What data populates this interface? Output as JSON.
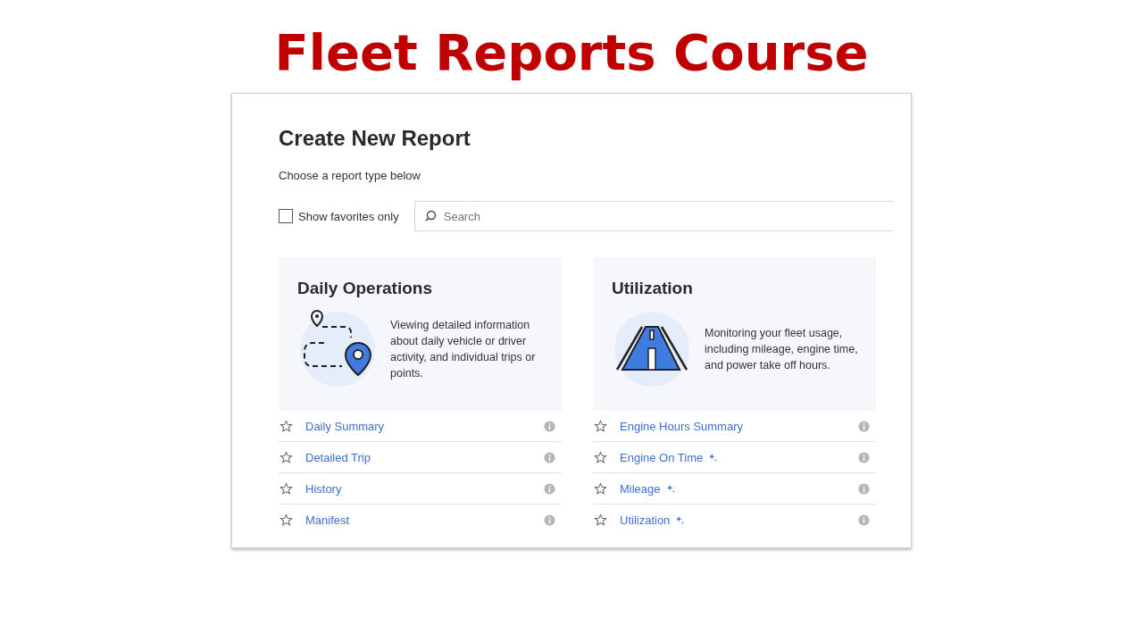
{
  "slide_title": "Fleet Reports Course",
  "page": {
    "title": "Create New Report",
    "subtitle": "Choose a report type below",
    "favorites_filter": {
      "label": "Show favorites only",
      "checked": false
    },
    "search": {
      "placeholder": "Search"
    },
    "categories": [
      {
        "title": "Daily Operations",
        "kind": "route",
        "description": "Viewing detailed information about daily vehicle or driver activity, and individual trips or points.",
        "reports": [
          {
            "name": "Daily Summary",
            "favorite": false,
            "new": false
          },
          {
            "name": "Detailed Trip",
            "favorite": false,
            "new": false
          },
          {
            "name": "History",
            "favorite": false,
            "new": false
          },
          {
            "name": "Manifest",
            "favorite": false,
            "new": false
          }
        ]
      },
      {
        "title": "Utilization",
        "kind": "road",
        "description": "Monitoring your fleet usage, including mileage, engine time, and power take off hours.",
        "reports": [
          {
            "name": "Engine Hours Summary",
            "favorite": false,
            "new": false
          },
          {
            "name": "Engine On Time",
            "favorite": false,
            "new": true
          },
          {
            "name": "Mileage",
            "favorite": false,
            "new": true
          },
          {
            "name": "Utilization",
            "favorite": false,
            "new": true
          }
        ]
      }
    ]
  }
}
